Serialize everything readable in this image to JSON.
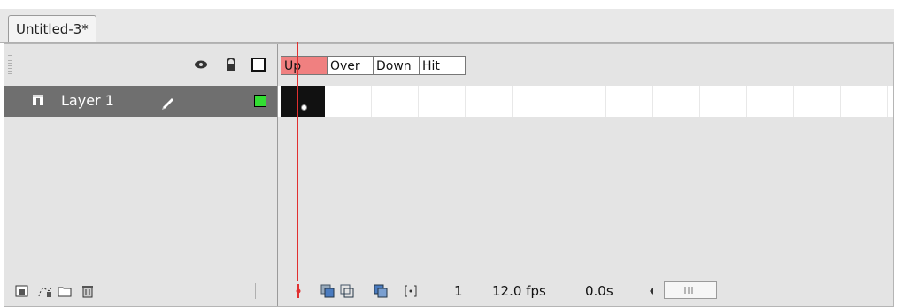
{
  "document": {
    "tab_title": "Untitled-3*"
  },
  "header": {
    "icons": [
      "eye-icon",
      "lock-icon",
      "outline-icon"
    ],
    "states": [
      {
        "label": "Up",
        "active": true
      },
      {
        "label": "Over",
        "active": false
      },
      {
        "label": "Down",
        "active": false
      },
      {
        "label": "Hit",
        "active": false
      }
    ]
  },
  "layers": [
    {
      "name": "Layer 1",
      "color": "#33dd33"
    }
  ],
  "status": {
    "current_frame": "1",
    "frame_rate": "12.0 fps",
    "elapsed_time": "0.0s"
  },
  "colors": {
    "playhead": "#e03030",
    "active_state": "#f08080",
    "selected_layer": "#6f6f6f"
  }
}
